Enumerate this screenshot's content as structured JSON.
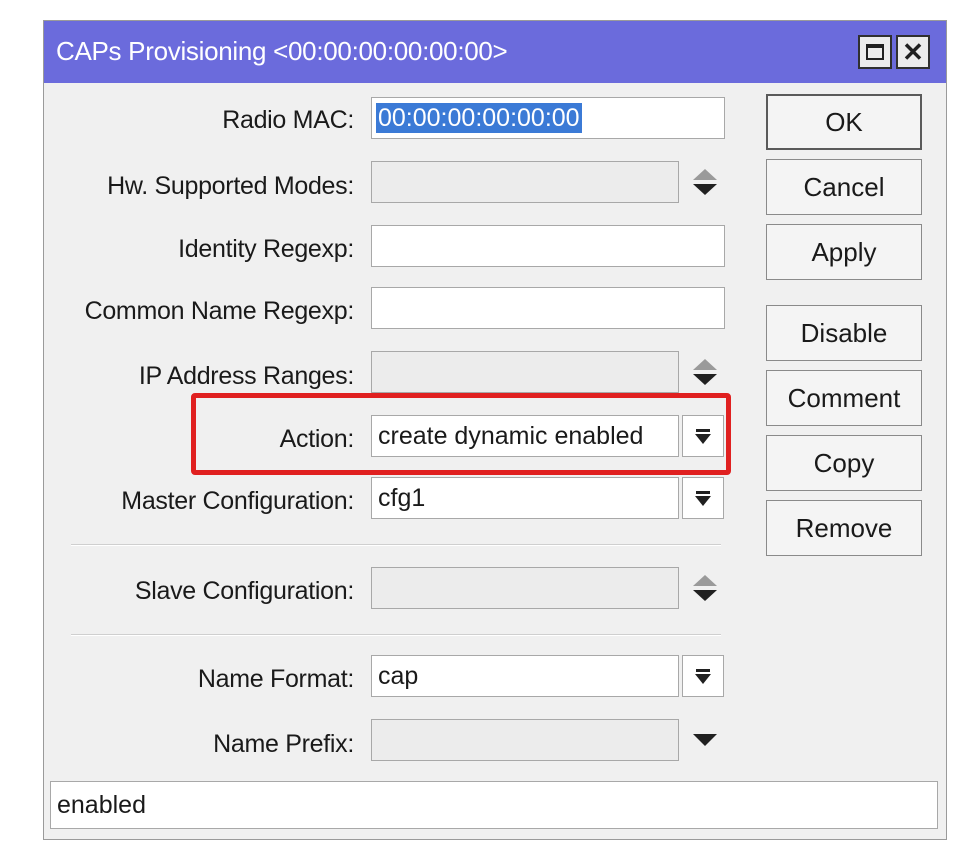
{
  "window": {
    "title": "CAPs Provisioning <00:00:00:00:00:00>",
    "accent_color": "#6b6bdc",
    "controls": [
      "maximize-icon",
      "close-icon"
    ]
  },
  "form": {
    "radio_mac": {
      "label": "Radio MAC:",
      "value": "00:00:00:00:00:00"
    },
    "hw_modes": {
      "label": "Hw. Supported Modes:",
      "value": ""
    },
    "identity_regexp": {
      "label": "Identity Regexp:",
      "value": ""
    },
    "common_name_regexp": {
      "label": "Common Name Regexp:",
      "value": ""
    },
    "ip_ranges": {
      "label": "IP Address Ranges:",
      "value": ""
    },
    "action": {
      "label": "Action:",
      "value": "create dynamic enabled"
    },
    "master_config": {
      "label": "Master Configuration:",
      "value": "cfg1"
    },
    "slave_config": {
      "label": "Slave Configuration:",
      "value": ""
    },
    "name_format": {
      "label": "Name Format:",
      "value": "cap"
    },
    "name_prefix": {
      "label": "Name Prefix:",
      "value": ""
    }
  },
  "buttons": {
    "ok": "OK",
    "cancel": "Cancel",
    "apply": "Apply",
    "disable": "Disable",
    "comment": "Comment",
    "copy": "Copy",
    "remove": "Remove"
  },
  "status": {
    "text": "enabled"
  },
  "highlight_color": "#e02020"
}
